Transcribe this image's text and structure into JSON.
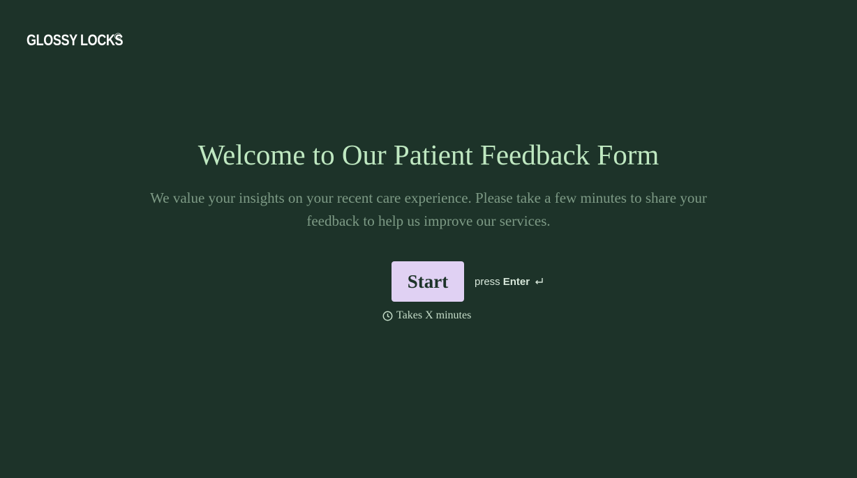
{
  "brand": {
    "name": "GLOSSY LOCKS",
    "mark": "©"
  },
  "welcome": {
    "title": "Welcome to Our Patient Feedback Form",
    "subtitle": "We value your insights on your recent care experience. Please take a few minutes to share your feedback to help us improve our services."
  },
  "actions": {
    "start_label": "Start",
    "hint_prefix": "press",
    "hint_key": "Enter",
    "hint_icon": "enter-key-icon"
  },
  "duration": {
    "icon": "clock-icon",
    "text": "Takes X minutes"
  },
  "colors": {
    "background": "#1d3329",
    "title": "#bfe8c1",
    "subtitle": "#7d9a85",
    "button": "#e0d1f3"
  }
}
